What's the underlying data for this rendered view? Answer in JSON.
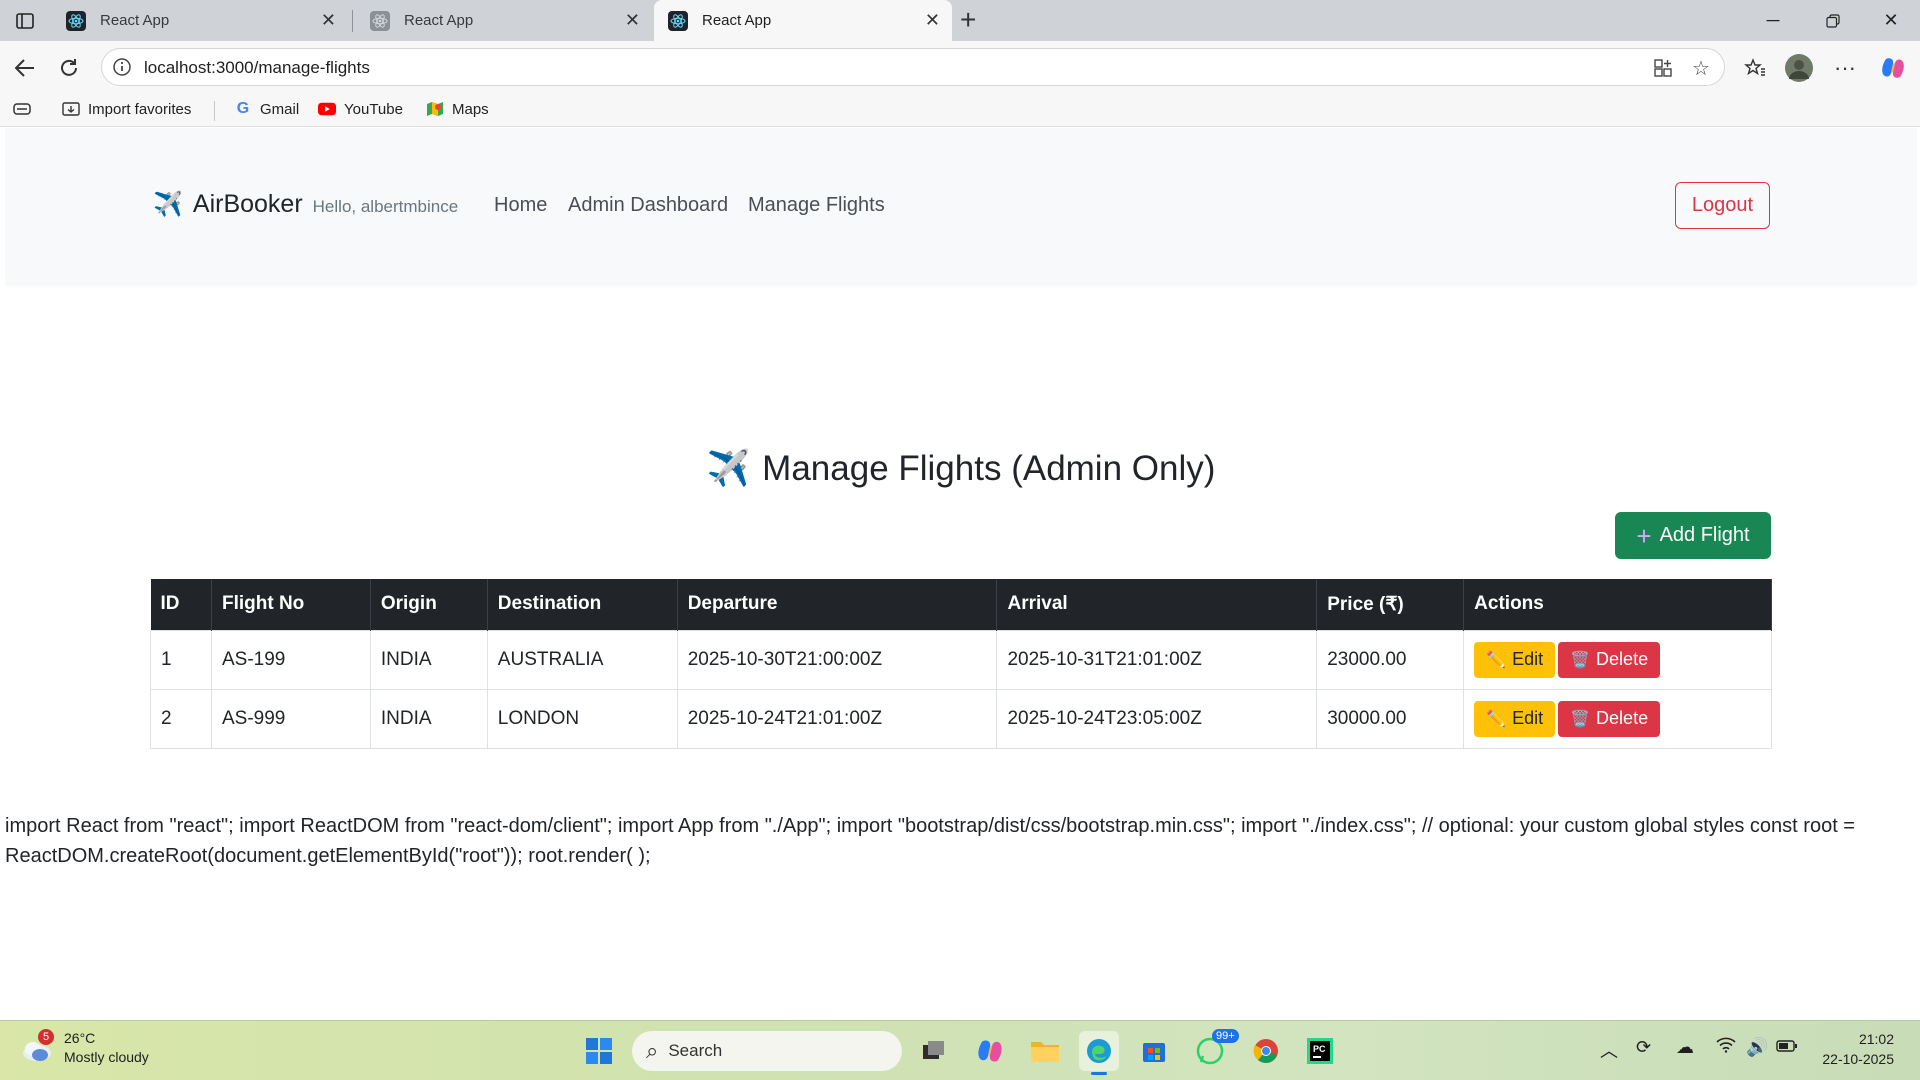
{
  "browser": {
    "tabs": [
      {
        "title": "React App"
      },
      {
        "title": "React App"
      },
      {
        "title": "React App"
      }
    ],
    "url": "localhost:3000/manage-flights",
    "bookmarks": [
      {
        "label": "Import favorites"
      },
      {
        "label": "Gmail"
      },
      {
        "label": "YouTube"
      },
      {
        "label": "Maps"
      }
    ]
  },
  "navbar": {
    "brand": "AirBooker",
    "greeting": "Hello, albertmbince",
    "links": [
      {
        "label": "Home"
      },
      {
        "label": "Admin Dashboard"
      },
      {
        "label": "Manage Flights"
      }
    ],
    "logout": "Logout"
  },
  "page": {
    "title": "Manage Flights (Admin Only)",
    "add_button": "Add Flight",
    "footer_text": "import React from \"react\"; import ReactDOM from \"react-dom/client\"; import App from \"./App\"; import \"bootstrap/dist/css/bootstrap.min.css\"; import \"./index.css\"; // optional: your custom global styles const root = ReactDOM.createRoot(document.getElementById(\"root\")); root.render( );"
  },
  "table": {
    "headers": [
      "ID",
      "Flight No",
      "Origin",
      "Destination",
      "Departure",
      "Arrival",
      "Price (₹)",
      "Actions"
    ],
    "rows": [
      {
        "id": "1",
        "flight_no": "AS-199",
        "origin": "INDIA",
        "destination": "AUSTRALIA",
        "departure": "2025-10-30T21:00:00Z",
        "arrival": "2025-10-31T21:01:00Z",
        "price": "23000.00"
      },
      {
        "id": "2",
        "flight_no": "AS-999",
        "origin": "INDIA",
        "destination": "LONDON",
        "departure": "2025-10-24T21:01:00Z",
        "arrival": "2025-10-24T23:05:00Z",
        "price": "30000.00"
      }
    ],
    "edit_label": "Edit",
    "delete_label": "Delete"
  },
  "taskbar": {
    "weather_temp": "26°C",
    "weather_desc": "Mostly cloudy",
    "weather_badge": "5",
    "search_label": "Search",
    "whatsapp_badge": "99+",
    "time": "21:02",
    "date": "22-10-2025"
  },
  "colors": {
    "success": "#198754",
    "danger": "#dc3545",
    "warning": "#ffc107",
    "dark": "#212529"
  }
}
